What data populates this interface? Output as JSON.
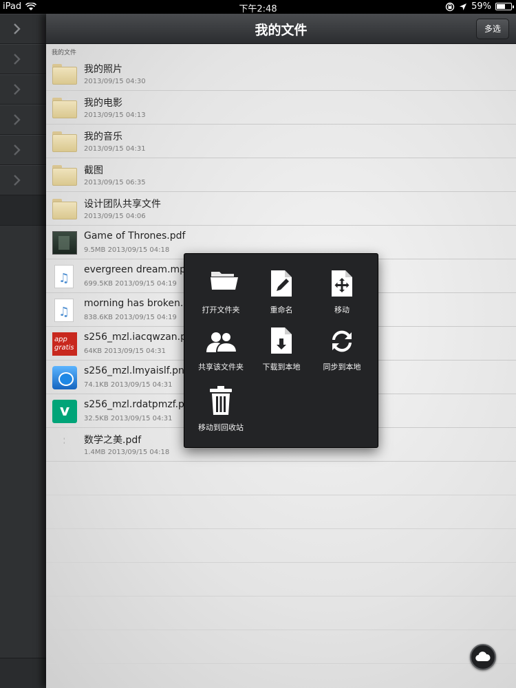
{
  "statusbar": {
    "device": "iPad",
    "time": "下午2:48",
    "battery": "59%",
    "battery_level": 0.59,
    "icons": [
      "wifi-icon",
      "rotation-lock-icon",
      "location-icon",
      "battery-icon"
    ]
  },
  "navbar": {
    "title": "我的文件",
    "multi_select_label": "多选"
  },
  "breadcrumb": "我的文件",
  "files": [
    {
      "name": "我的照片",
      "meta": "2013/09/15 04:30",
      "icon": "folder-icon"
    },
    {
      "name": "我的电影",
      "meta": "2013/09/15 04:13",
      "icon": "folder-icon"
    },
    {
      "name": "我的音乐",
      "meta": "2013/09/15 04:31",
      "icon": "folder-icon"
    },
    {
      "name": "截图",
      "meta": "2013/09/15 06:35",
      "icon": "folder-icon"
    },
    {
      "name": "设计团队共享文件",
      "meta": "2013/09/15 04:06",
      "icon": "folder-icon"
    },
    {
      "name": "Game of Thrones.pdf",
      "meta": "9.5MB 2013/09/15 04:18",
      "icon": "pdf-thumbnail-icon"
    },
    {
      "name": "evergreen dream.mp3",
      "meta": "699.5KB 2013/09/15 04:19",
      "icon": "music-file-icon"
    },
    {
      "name": "morning has broken.mp3",
      "meta": "838.6KB 2013/09/15 04:19",
      "icon": "music-file-icon"
    },
    {
      "name": "s256_mzl.iacqwzan.png",
      "meta": "64KB 2013/09/15 04:31",
      "icon": "app-gratis-thumbnail-icon",
      "thumb_text": "app gratis"
    },
    {
      "name": "s256_mzl.lmyaislf.png",
      "meta": "74.1KB 2013/09/15 04:31",
      "icon": "bird-thumbnail-icon"
    },
    {
      "name": "s256_mzl.rdatpmzf.png",
      "meta": "32.5KB 2013/09/15 04:31",
      "icon": "vine-thumbnail-icon",
      "thumb_text": "v"
    },
    {
      "name": "数学之美.pdf",
      "meta": "1.4MB 2013/09/15 04:18",
      "icon": "blank-file-icon"
    }
  ],
  "context_menu": {
    "items": [
      {
        "label": "打开文件夹",
        "icon": "open-folder-icon"
      },
      {
        "label": "重命名",
        "icon": "rename-icon"
      },
      {
        "label": "移动",
        "icon": "move-icon"
      },
      {
        "label": "共享该文件夹",
        "icon": "share-users-icon"
      },
      {
        "label": "下载到本地",
        "icon": "download-icon"
      },
      {
        "label": "同步到本地",
        "icon": "sync-icon"
      },
      {
        "label": "移动到回收站",
        "icon": "trash-icon"
      }
    ]
  },
  "colors": {
    "navbar_top": "#4a4c4f",
    "navbar_bottom": "#2b2d30",
    "sidebar": "#2f3133",
    "menu_bg": "#232426",
    "folder": "#e6d6a6"
  }
}
